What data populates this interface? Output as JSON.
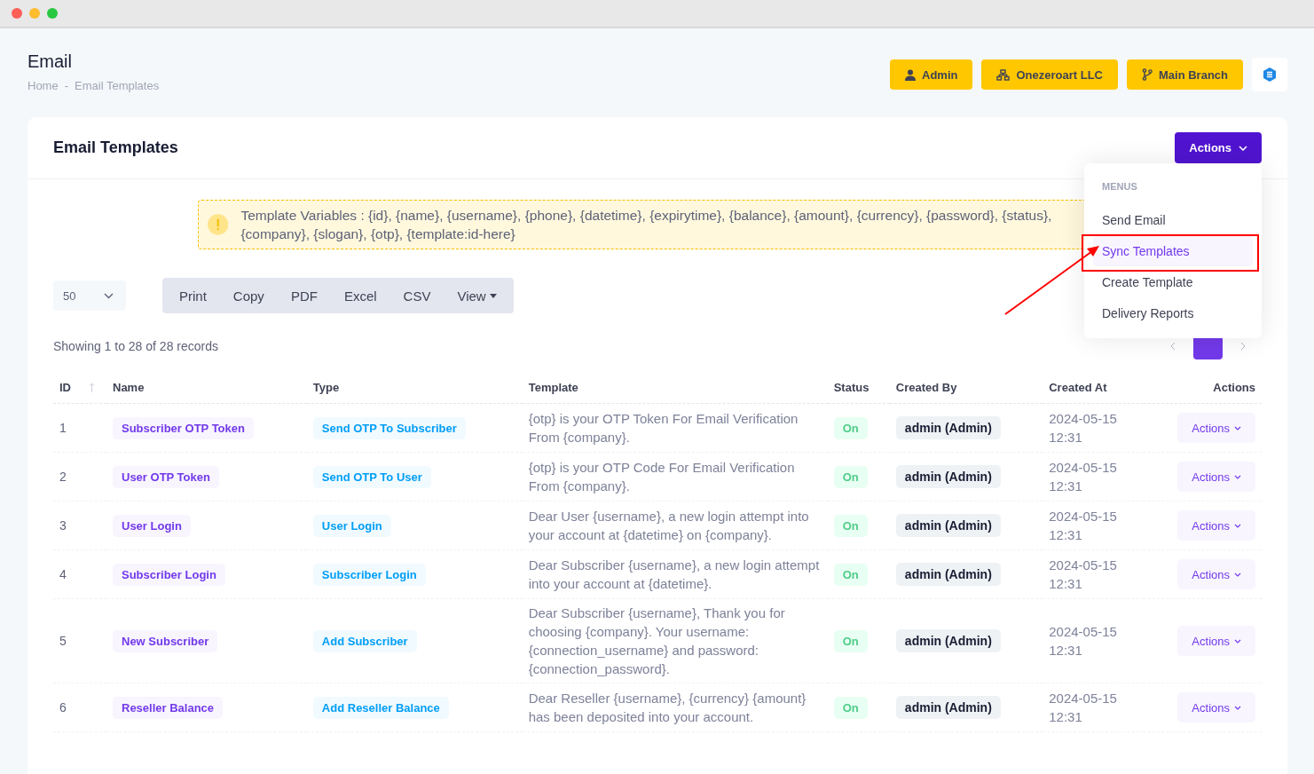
{
  "page": {
    "title": "Email",
    "breadcrumb": [
      "Home",
      "Email Templates"
    ],
    "breadcrumb_separator": "-"
  },
  "header_buttons": [
    {
      "kind": "user",
      "label": "Admin"
    },
    {
      "kind": "org",
      "label": "Onezeroart LLC"
    },
    {
      "kind": "branch",
      "label": "Main Branch"
    }
  ],
  "card": {
    "title": "Email Templates",
    "actions_button": "Actions"
  },
  "alert": {
    "text": "Template Variables : {id}, {name}, {username}, {phone}, {datetime}, {expirytime}, {balance}, {amount}, {currency}, {password}, {status}, {company}, {slogan}, {otp}, {template:id-here}"
  },
  "page_size": "50",
  "export_buttons": [
    {
      "label": "Print",
      "dropdown": false
    },
    {
      "label": "Copy",
      "dropdown": false
    },
    {
      "label": "PDF",
      "dropdown": false
    },
    {
      "label": "Excel",
      "dropdown": false
    },
    {
      "label": "CSV",
      "dropdown": false
    },
    {
      "label": "View",
      "dropdown": true
    }
  ],
  "records_info": "Showing 1 to 28 of 28 records",
  "menu": {
    "heading": "MENUS",
    "items": [
      {
        "label": "Send Email",
        "selected": false
      },
      {
        "label": "Sync Templates",
        "selected": true
      },
      {
        "label": "Create Template",
        "selected": false
      },
      {
        "label": "Delivery Reports",
        "selected": false
      }
    ]
  },
  "table": {
    "columns": [
      "ID",
      "Name",
      "Type",
      "Template",
      "Status",
      "Created By",
      "Created At",
      "Actions"
    ],
    "rows": [
      {
        "id": "1",
        "name": "Subscriber OTP Token",
        "type": "Send OTP To Subscriber",
        "template": "{otp} is your OTP Token For Email Verification From {company}.",
        "status": "On",
        "created_by": "admin (Admin)",
        "created_at": "2024-05-15 12:31",
        "action": "Actions"
      },
      {
        "id": "2",
        "name": "User OTP Token",
        "type": "Send OTP To User",
        "template": "{otp} is your OTP Code For Email Verification From {company}.",
        "status": "On",
        "created_by": "admin (Admin)",
        "created_at": "2024-05-15 12:31",
        "action": "Actions"
      },
      {
        "id": "3",
        "name": "User Login",
        "type": "User Login",
        "template": "Dear User {username}, a new login attempt into your account at {datetime} on {company}.",
        "status": "On",
        "created_by": "admin (Admin)",
        "created_at": "2024-05-15 12:31",
        "action": "Actions"
      },
      {
        "id": "4",
        "name": "Subscriber Login",
        "type": "Subscriber Login",
        "template": "Dear Subscriber {username}, a new login attempt into your account at {datetime}.",
        "status": "On",
        "created_by": "admin (Admin)",
        "created_at": "2024-05-15 12:31",
        "action": "Actions"
      },
      {
        "id": "5",
        "name": "New Subscriber",
        "type": "Add Subscriber",
        "template": "Dear Subscriber {username}, Thank you for choosing {company}. Your username: {connection_username} and password: {connection_password}.",
        "status": "On",
        "created_by": "admin (Admin)",
        "created_at": "2024-05-15 12:31",
        "action": "Actions"
      },
      {
        "id": "6",
        "name": "Reseller Balance",
        "type": "Add Reseller Balance",
        "template": "Dear Reseller {username}, {currency} {amount} has been deposited into your account.",
        "status": "On",
        "created_by": "admin (Admin)",
        "created_at": "2024-05-15 12:31",
        "action": "Actions"
      }
    ]
  }
}
